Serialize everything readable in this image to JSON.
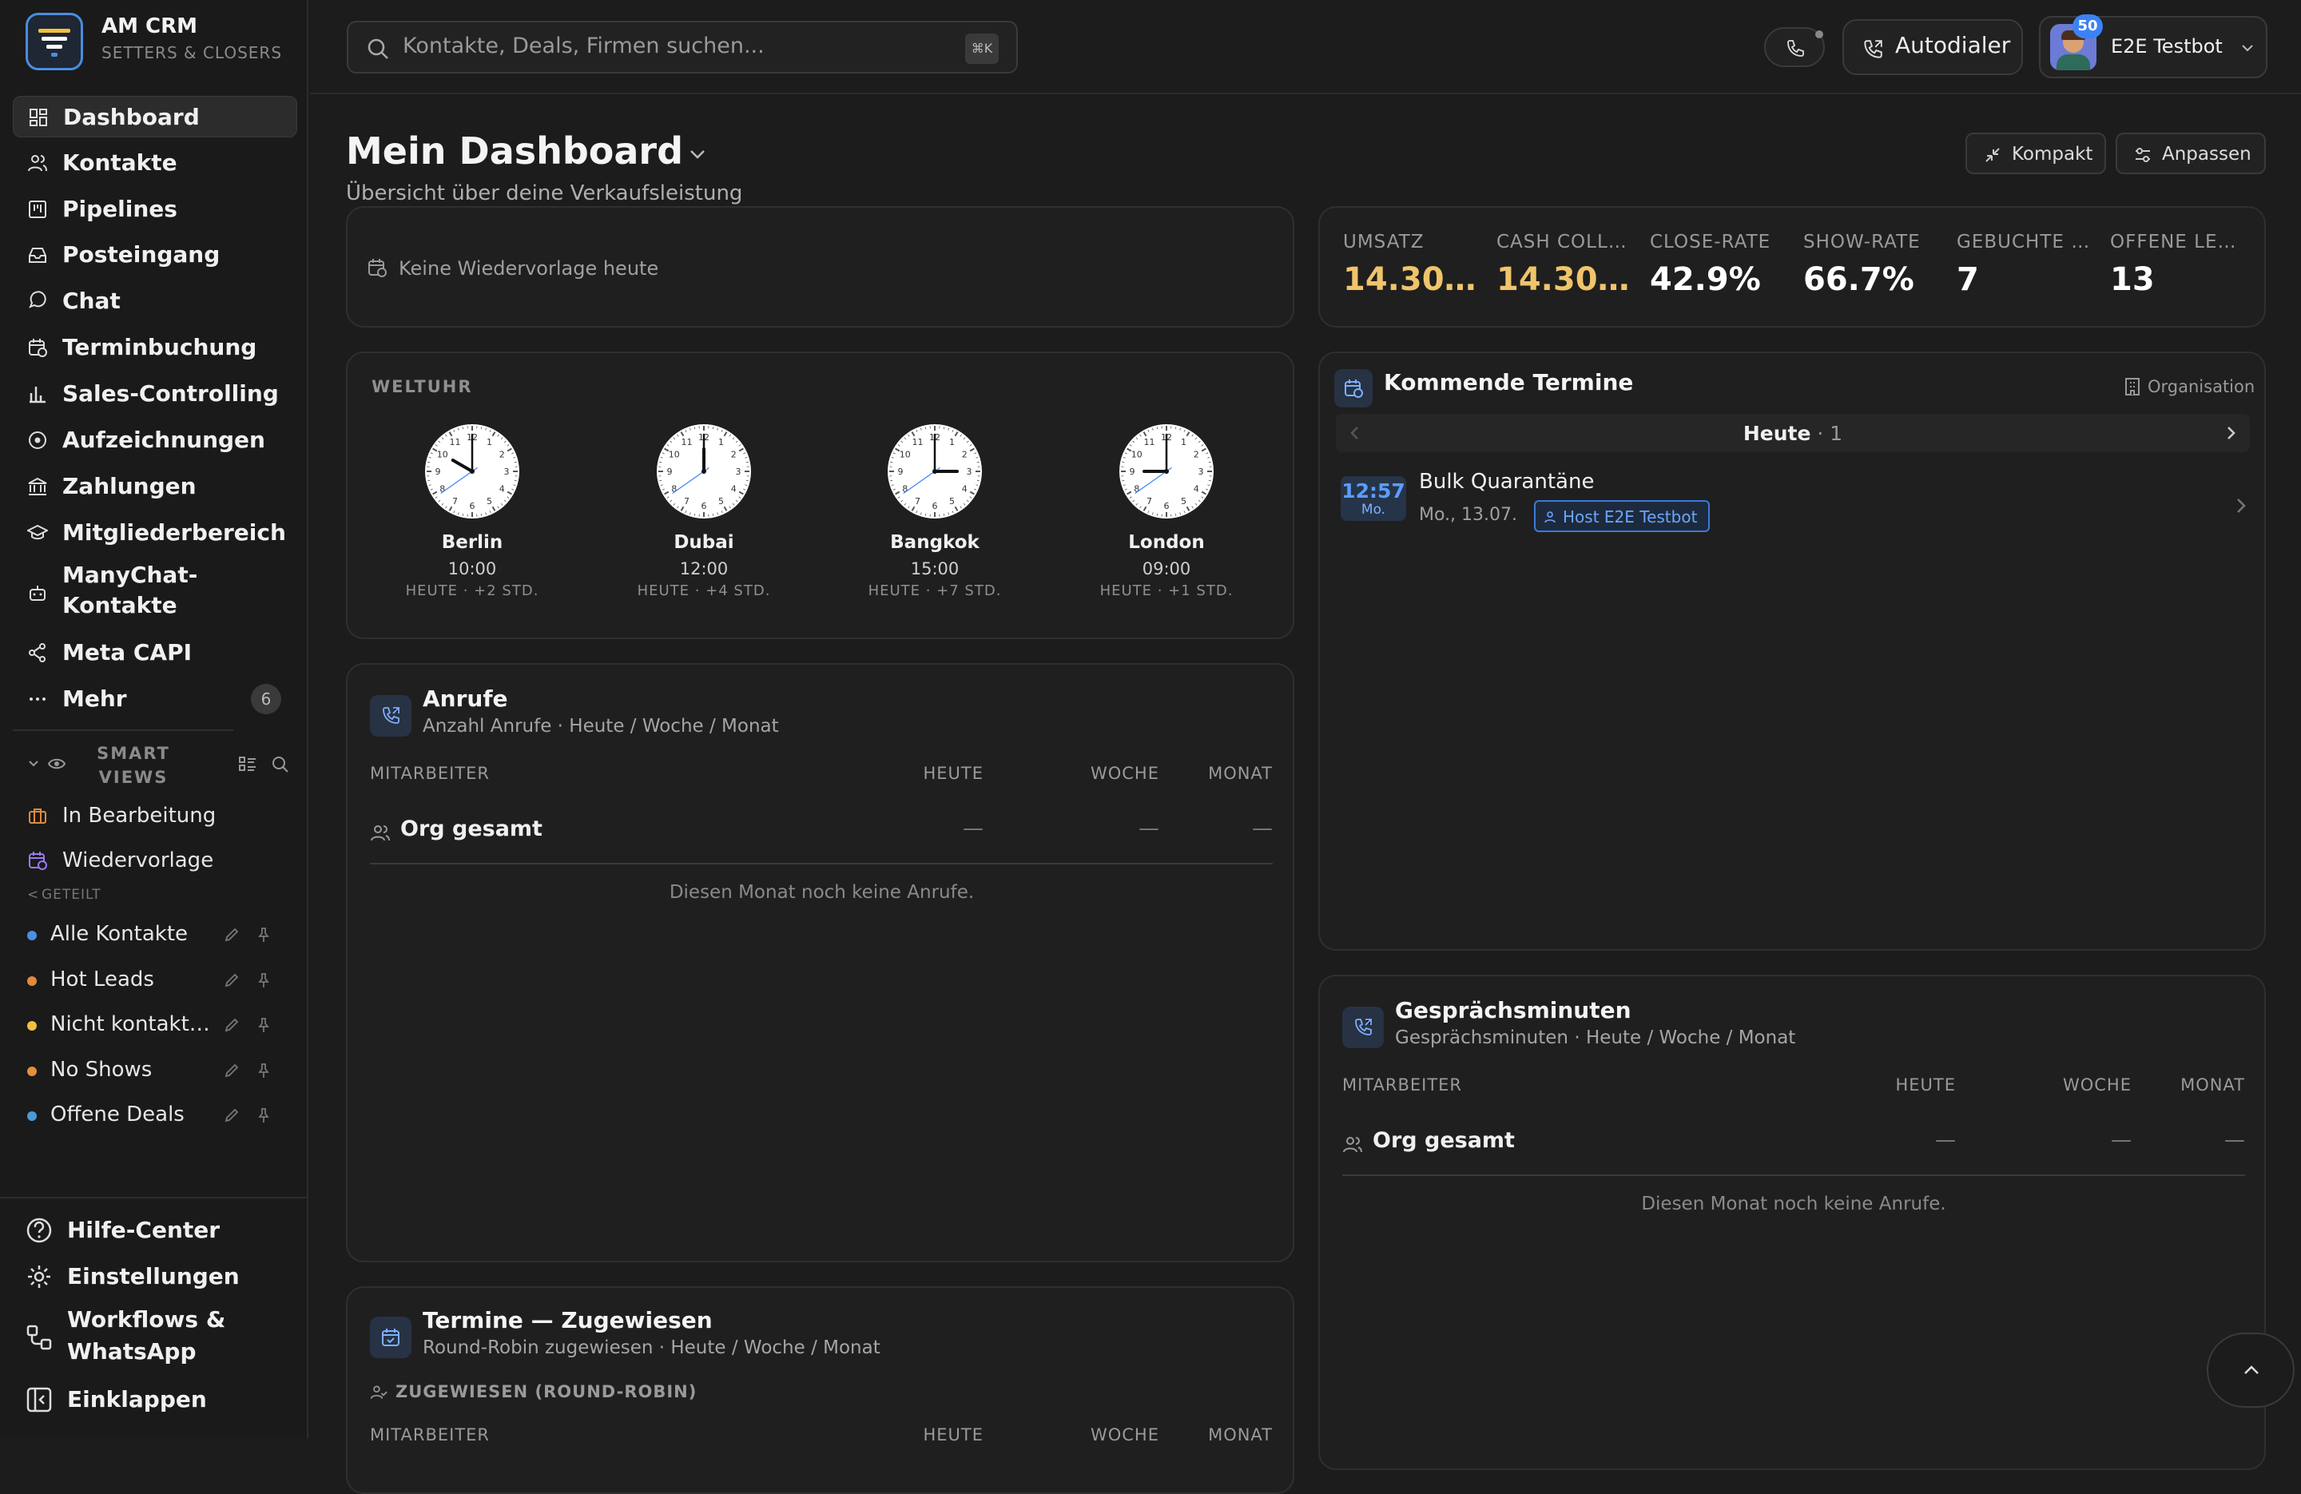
{
  "brand": {
    "title": "AM CRM",
    "subtitle": "SETTERS & CLOSERS"
  },
  "nav": [
    {
      "label": "Dashboard",
      "icon": "dashboard-icon",
      "active": true
    },
    {
      "label": "Kontakte",
      "icon": "users-icon"
    },
    {
      "label": "Pipelines",
      "icon": "kanban-icon"
    },
    {
      "label": "Posteingang",
      "icon": "inbox-icon"
    },
    {
      "label": "Chat",
      "icon": "chat-icon"
    },
    {
      "label": "Terminbuchung",
      "icon": "calendar-clock-icon"
    },
    {
      "label": "Sales-Controlling",
      "icon": "bar-chart-icon"
    },
    {
      "label": "Aufzeichnungen",
      "icon": "record-icon"
    },
    {
      "label": "Zahlungen",
      "icon": "bank-icon"
    },
    {
      "label": "Mitgliederbereich",
      "icon": "graduation-cap-icon"
    },
    {
      "label": "ManyChat-Kontakte",
      "icon": "bot-icon"
    },
    {
      "label": "Meta CAPI",
      "icon": "share-icon"
    },
    {
      "label": "Mehr",
      "icon": "more-icon",
      "badge": "6"
    }
  ],
  "smart_views": {
    "header": "SMART VIEWS",
    "shared_label": "GETEILT",
    "items": [
      {
        "label": "In Bearbeitung",
        "icon": "briefcase-icon"
      },
      {
        "label": "Wiedervorlage",
        "icon": "calendar-clock-icon"
      }
    ],
    "shared": [
      {
        "label": "Alle Kontakte",
        "color": "#4a90e2"
      },
      {
        "label": "Hot Leads",
        "color": "#e08a3c"
      },
      {
        "label": "Nicht kontakt…",
        "color": "#f0c040"
      },
      {
        "label": "No Shows",
        "color": "#e0913c"
      },
      {
        "label": "Offene Deals",
        "color": "#4a9ad8"
      }
    ]
  },
  "bottom_nav": [
    {
      "label": "Hilfe-Center",
      "icon": "help-icon"
    },
    {
      "label": "Einstellungen",
      "icon": "gear-icon"
    },
    {
      "label": "Workflows & WhatsApp",
      "icon": "workflow-icon"
    },
    {
      "label": "Einklappen",
      "icon": "collapse-icon"
    }
  ],
  "header": {
    "search_placeholder": "Kontakte, Deals, Firmen suchen...",
    "search_shortcut": "⌘K",
    "autodialer_label": "Autodialer",
    "user_name": "E2E Testbot",
    "user_badge": "50"
  },
  "page": {
    "title": "Mein Dashboard",
    "subtitle": "Übersicht über deine Verkaufsleistung",
    "compact_label": "Kompakt",
    "customize_label": "Anpassen"
  },
  "followup": {
    "text": "Keine Wiedervorlage heute"
  },
  "kpis": [
    {
      "label": "UMSATZ",
      "value": "14.30…",
      "accent": "#f0c46a"
    },
    {
      "label": "CASH COLL…",
      "value": "14.30…",
      "accent": "#f0c46a"
    },
    {
      "label": "CLOSE-RATE",
      "value": "42.9%",
      "accent": "#ffffff"
    },
    {
      "label": "SHOW-RATE",
      "value": "66.7%",
      "accent": "#ffffff"
    },
    {
      "label": "GEBUCHTE …",
      "value": "7",
      "accent": "#ffffff"
    },
    {
      "label": "OFFENE LE…",
      "value": "13",
      "accent": "#ffffff"
    }
  ],
  "world_clock": {
    "title": "WELTUHR",
    "clocks": [
      {
        "city": "Berlin",
        "time": "10:00",
        "offset": "HEUTE · +2 STD.",
        "hour": 10,
        "minute": 0
      },
      {
        "city": "Dubai",
        "time": "12:00",
        "offset": "HEUTE · +4 STD.",
        "hour": 12,
        "minute": 0
      },
      {
        "city": "Bangkok",
        "time": "15:00",
        "offset": "HEUTE · +7 STD.",
        "hour": 15,
        "minute": 0
      },
      {
        "city": "London",
        "time": "09:00",
        "offset": "HEUTE · +1 STD.",
        "hour": 9,
        "minute": 0
      }
    ]
  },
  "appointments": {
    "title": "Kommende Termine",
    "scope": "Organisation",
    "day_label": "Heute",
    "day_count": "· 1",
    "items": [
      {
        "time": "12:57",
        "weekday": "Mo.",
        "title": "Bulk Quarantäne",
        "date": "Mo., 13.07.",
        "host_label": "Host",
        "host_name": "E2E Testbot"
      }
    ]
  },
  "calls": {
    "title": "Anrufe",
    "subtitle": "Anzahl Anrufe · Heute / Woche / Monat",
    "columns": [
      "MITARBEITER",
      "HEUTE",
      "WOCHE",
      "MONAT"
    ],
    "row": {
      "label": "Org gesamt",
      "today": "—",
      "week": "—",
      "month": "—"
    },
    "empty": "Diesen Monat noch keine Anrufe."
  },
  "minutes": {
    "title": "Gesprächsminuten",
    "subtitle": "Gesprächsminuten · Heute / Woche / Monat",
    "columns": [
      "MITARBEITER",
      "HEUTE",
      "WOCHE",
      "MONAT"
    ],
    "row": {
      "label": "Org gesamt",
      "today": "—",
      "week": "—",
      "month": "—"
    },
    "empty": "Diesen Monat noch keine Anrufe."
  },
  "assigned": {
    "title": "Termine — Zugewiesen",
    "subtitle": "Round-Robin zugewiesen · Heute / Woche / Monat",
    "section": "ZUGEWIESEN (ROUND-ROBIN)",
    "columns": [
      "MITARBEITER",
      "HEUTE",
      "WOCHE",
      "MONAT"
    ]
  }
}
